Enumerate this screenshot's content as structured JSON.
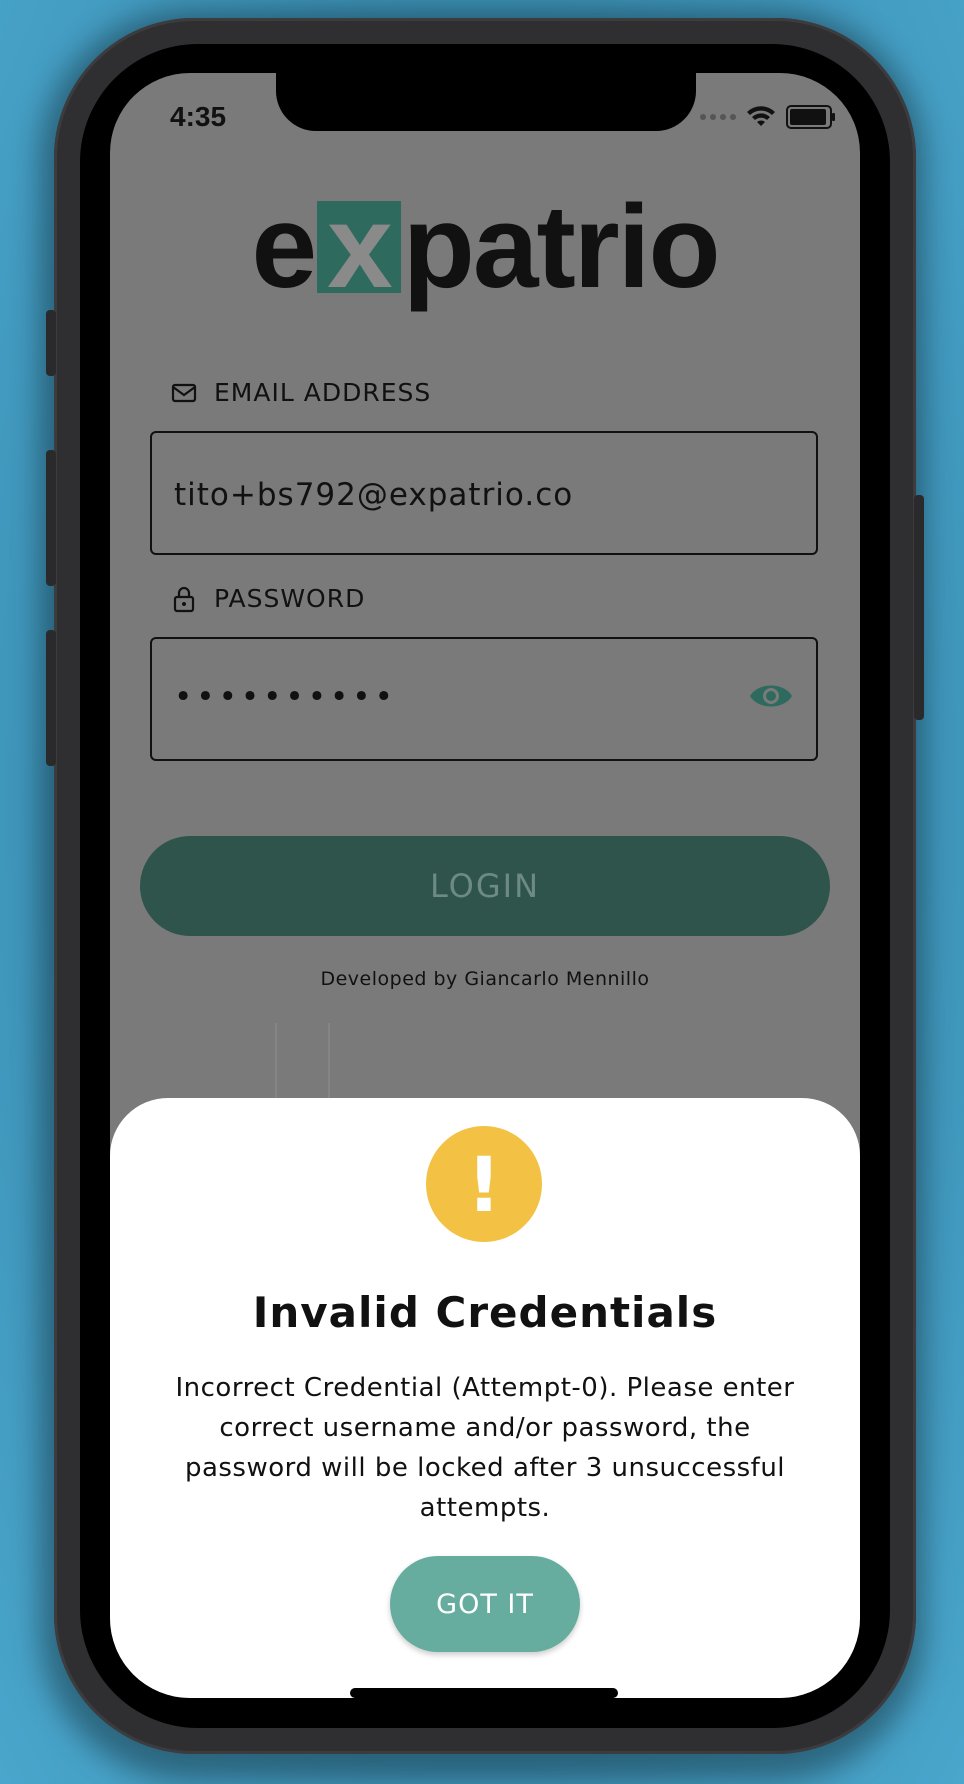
{
  "status_bar": {
    "time": "4:35"
  },
  "logo": {
    "prefix": "e",
    "boxed_letter": "x",
    "suffix": "patrio"
  },
  "email": {
    "label": "EMAIL ADDRESS",
    "value": "tito+bs792@expatrio.co"
  },
  "password": {
    "label": "PASSWORD",
    "value": "••••••••••"
  },
  "login": {
    "label": "LOGIN"
  },
  "credit": "Developed by Giancarlo Mennillo",
  "dialog": {
    "icon": "!",
    "title": "Invalid Credentials",
    "message": "Incorrect Credential (Attempt-0). Please enter correct username and/or password, the password will be locked after 3 unsuccessful attempts.",
    "button": "GOT IT"
  },
  "colors": {
    "accent": "#66ad9f",
    "brand_dark": "#2f6a5f",
    "warning": "#f3c244"
  },
  "icons": {
    "email": "envelope-icon",
    "password": "lock-icon",
    "visibility": "eye-icon",
    "warning": "warning-icon"
  }
}
